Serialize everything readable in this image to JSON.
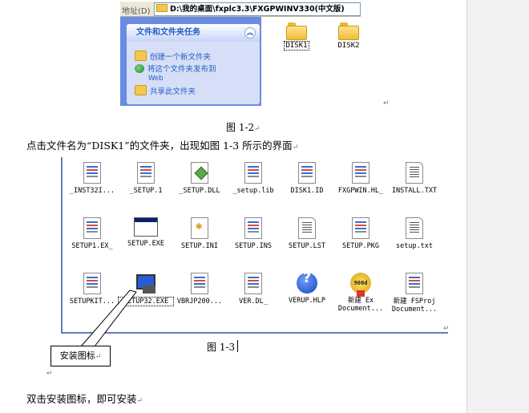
{
  "fig12": {
    "address_label": "地址(D)",
    "address_path": "D:\\我的桌面\\fxplc3.3\\FXGPWINV330(中文版)",
    "task_header": "文件和文件夹任务",
    "collapse_symbol": "︽",
    "tasks": [
      "创建一个新文件夹",
      "将这个文件夹发布到",
      "Web",
      "共享此文件夹"
    ],
    "folders": [
      "DISK1",
      "DISK2"
    ],
    "caption": "图 1-2"
  },
  "paragraph1": "点击文件名为“DISK1”的文件夹，出现如图 1-3 所示的界面",
  "fig13": {
    "files": [
      {
        "name": "_INST32I...",
        "icon": "doc-icon"
      },
      {
        "name": "_SETUP.1",
        "icon": "doc-icon"
      },
      {
        "name": "_SETUP.DLL",
        "icon": "dll-icon"
      },
      {
        "name": "_setup.lib",
        "icon": "doc-icon"
      },
      {
        "name": "DISK1.ID",
        "icon": "doc-icon"
      },
      {
        "name": "FXGPWIN.HL_",
        "icon": "doc-icon"
      },
      {
        "name": "INSTALL.TXT",
        "icon": "text-icon"
      },
      {
        "name": "SETUP1.EX_",
        "icon": "doc-icon"
      },
      {
        "name": "SETUP.EXE",
        "icon": "exe-icon"
      },
      {
        "name": "SETUP.INI",
        "icon": "ini-icon"
      },
      {
        "name": "SETUP.INS",
        "icon": "doc-icon"
      },
      {
        "name": "SETUP.LST",
        "icon": "text-icon"
      },
      {
        "name": "SETUP.PKG",
        "icon": "doc-icon"
      },
      {
        "name": "setup.txt",
        "icon": "text-icon"
      },
      {
        "name": "SETUPKIT...",
        "icon": "doc-icon"
      },
      {
        "name": "SETUP32.EXE",
        "icon": "setup32-icon"
      },
      {
        "name": "VBRJP200...",
        "icon": "doc-icon"
      },
      {
        "name": "VER.DL_",
        "icon": "doc-icon"
      },
      {
        "name": "VERUP.HLP",
        "icon": "help-icon"
      },
      {
        "name": "新建 Ex\nDocument...",
        "icon": "badge-icon"
      },
      {
        "name": "新建 FSProj\nDocument...",
        "icon": "doc-icon"
      }
    ],
    "badge_text": "900d",
    "callout": "安装图标",
    "caption": "图 1-3"
  },
  "paragraph2": "双击安装图标，即可安装",
  "paragraph_mark": "↵"
}
